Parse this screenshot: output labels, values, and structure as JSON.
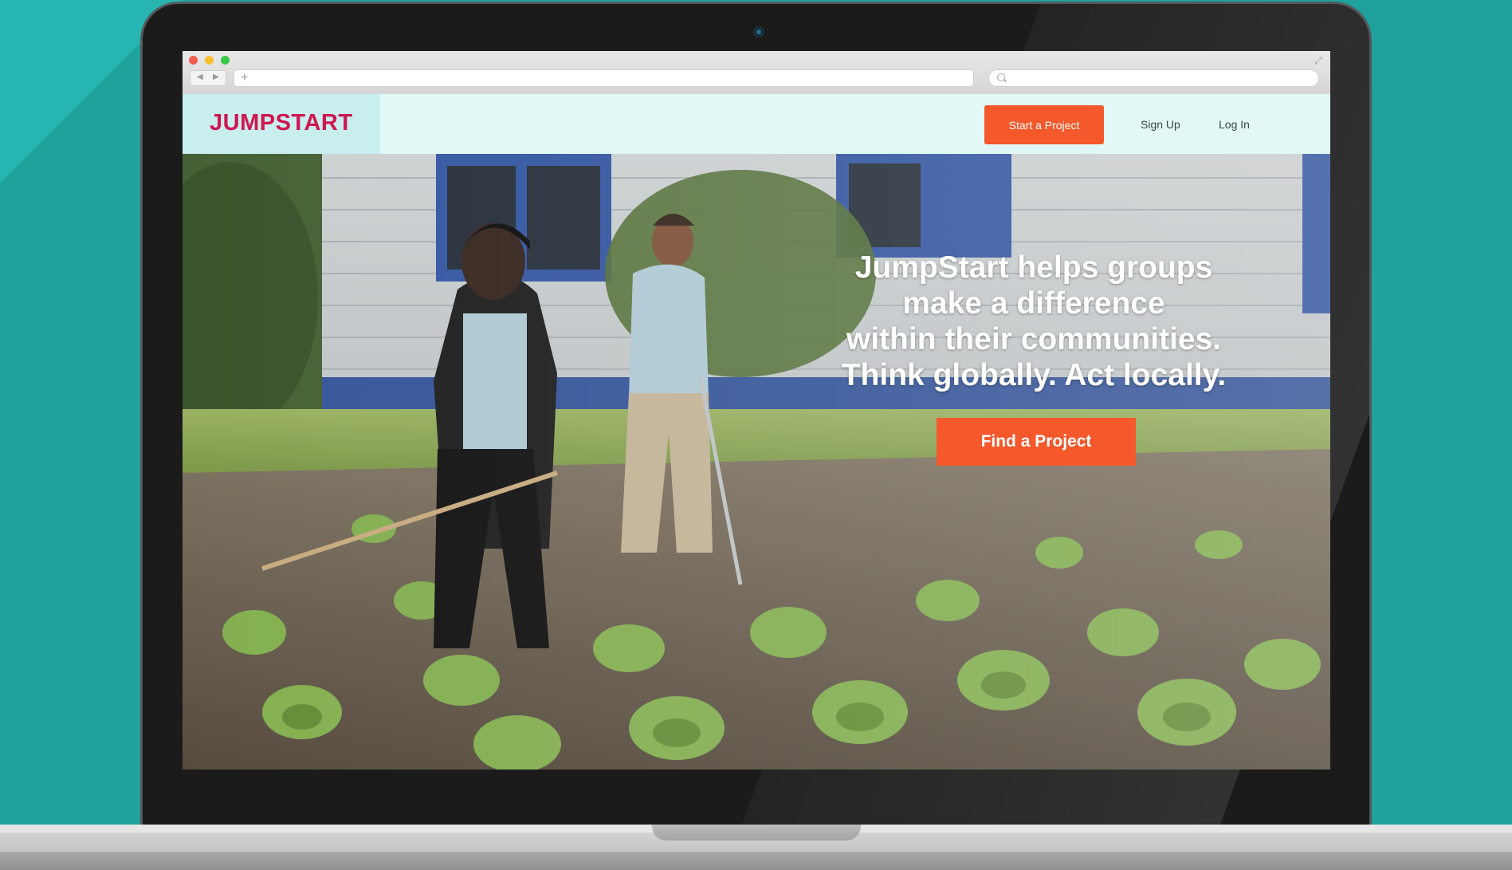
{
  "browser": {
    "url_placeholder": "+",
    "search_placeholder": ""
  },
  "site": {
    "logo": "JUMPSTART",
    "nav": {
      "start_project": "Start a Project",
      "sign_up": "Sign Up",
      "log_in": "Log In"
    },
    "hero": {
      "headline_lines": [
        "JumpStart helps groups",
        "make a difference",
        "within their communities.",
        "Think globally. Act locally."
      ],
      "cta": "Find a Project"
    }
  },
  "colors": {
    "background": "#23aeaa",
    "brand": "#d0174f",
    "accent": "#f4582b",
    "header_bg": "#e2f8f7"
  },
  "icons": {
    "back": "back-arrow-icon",
    "forward": "forward-arrow-icon",
    "plus": "plus-icon",
    "search": "search-icon",
    "expand": "expand-icon",
    "camera": "camera-icon"
  }
}
